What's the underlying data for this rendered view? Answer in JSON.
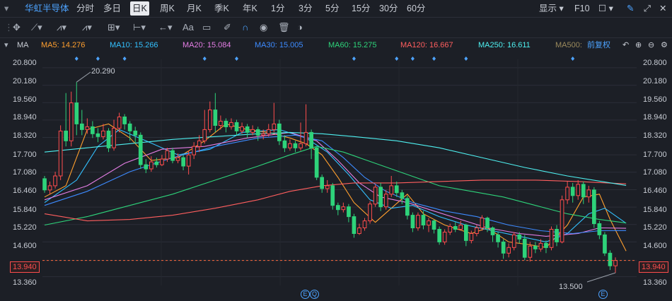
{
  "header": {
    "stock_name": "华虹半导体",
    "periods": [
      "分时",
      "多日",
      "日K",
      "周K",
      "月K",
      "季K",
      "年K",
      "1分",
      "3分",
      "5分",
      "15分",
      "30分",
      "60分"
    ],
    "active_period": "日K",
    "display_label": "显示",
    "f10_label": "F10"
  },
  "toolbar": {
    "text_label": "Aa"
  },
  "ma_bar": {
    "label": "MA",
    "items": [
      {
        "text": "MA5: 14.276",
        "color": "#ff9f2e"
      },
      {
        "text": "MA10: 15.266",
        "color": "#33c1ff"
      },
      {
        "text": "MA20: 15.084",
        "color": "#e57ee5"
      },
      {
        "text": "MA30: 15.005",
        "color": "#3d8bff"
      },
      {
        "text": "MA60: 15.275",
        "color": "#2ed37a"
      },
      {
        "text": "MA120: 16.667",
        "color": "#ff5e5e"
      },
      {
        "text": "MA250: 16.611",
        "color": "#4ef0f0"
      },
      {
        "text": "MA500:",
        "color": "#9b8a5c"
      }
    ],
    "adjust_label": "前复权"
  },
  "chart_data": {
    "type": "candlestick",
    "ylim": [
      13.05,
      21.1
    ],
    "yticks": [
      "20.800",
      "20.180",
      "19.560",
      "18.940",
      "18.320",
      "17.700",
      "17.080",
      "16.460",
      "15.840",
      "15.220",
      "14.600",
      "13.940",
      "13.360"
    ],
    "current_price": "13.940",
    "max_label": "20.290",
    "min_label": "13.500",
    "event_badges": [
      "E",
      "Q",
      "E"
    ],
    "up_color": "#ff4d4d",
    "down_color": "#2ed37a",
    "candles": [
      [
        16.85,
        16.45,
        16.95,
        16.35
      ],
      [
        16.45,
        16.6,
        16.75,
        16.3
      ],
      [
        16.6,
        16.95,
        17.1,
        16.5
      ],
      [
        16.95,
        18.55,
        18.75,
        16.8
      ],
      [
        18.55,
        18.2,
        19.9,
        18.0
      ],
      [
        18.2,
        19.55,
        19.95,
        18.0
      ],
      [
        19.55,
        18.8,
        20.29,
        18.4
      ],
      [
        18.8,
        18.6,
        19.3,
        18.4
      ],
      [
        18.6,
        18.7,
        19.0,
        18.45
      ],
      [
        18.7,
        18.45,
        18.9,
        18.3
      ],
      [
        18.45,
        18.35,
        18.65,
        18.15
      ],
      [
        18.35,
        18.55,
        18.8,
        18.25
      ],
      [
        18.55,
        17.95,
        18.65,
        17.8
      ],
      [
        17.95,
        18.65,
        18.95,
        17.85
      ],
      [
        18.65,
        19.05,
        19.2,
        18.5
      ],
      [
        19.05,
        18.8,
        19.15,
        18.6
      ],
      [
        18.8,
        18.55,
        18.9,
        18.2
      ],
      [
        18.55,
        18.4,
        18.7,
        18.1
      ],
      [
        18.4,
        17.35,
        18.5,
        17.2
      ],
      [
        17.35,
        17.2,
        17.55,
        17.05
      ],
      [
        17.2,
        17.45,
        17.65,
        17.1
      ],
      [
        17.45,
        17.35,
        17.6,
        17.25
      ],
      [
        17.35,
        17.55,
        17.7,
        17.3
      ],
      [
        17.55,
        17.85,
        17.95,
        17.45
      ],
      [
        17.85,
        17.5,
        17.95,
        17.4
      ],
      [
        17.5,
        17.6,
        17.75,
        17.4
      ],
      [
        17.6,
        17.3,
        17.7,
        17.15
      ],
      [
        17.3,
        17.7,
        17.85,
        17.0
      ],
      [
        17.7,
        18.0,
        18.15,
        17.55
      ],
      [
        18.0,
        18.2,
        18.4,
        17.8
      ],
      [
        18.2,
        18.6,
        19.3,
        18.1
      ],
      [
        18.6,
        19.3,
        19.6,
        18.5
      ],
      [
        19.3,
        18.75,
        19.9,
        18.5
      ],
      [
        18.75,
        18.9,
        19.1,
        18.6
      ],
      [
        18.9,
        18.7,
        19.0,
        18.5
      ],
      [
        18.7,
        18.85,
        19.0,
        18.6
      ],
      [
        18.85,
        18.55,
        18.95,
        18.4
      ],
      [
        18.55,
        18.7,
        18.85,
        18.45
      ],
      [
        18.7,
        18.5,
        18.8,
        18.3
      ],
      [
        18.5,
        18.6,
        18.75,
        18.4
      ],
      [
        18.6,
        18.4,
        18.7,
        18.2
      ],
      [
        18.4,
        18.45,
        18.6,
        18.25
      ],
      [
        18.45,
        18.6,
        18.8,
        18.35
      ],
      [
        18.6,
        18.8,
        19.55,
        18.5
      ],
      [
        18.8,
        18.2,
        18.95,
        18.05
      ],
      [
        18.2,
        17.95,
        18.4,
        17.8
      ],
      [
        17.95,
        18.1,
        18.25,
        17.85
      ],
      [
        18.1,
        17.95,
        18.2,
        17.8
      ],
      [
        17.95,
        18.1,
        18.85,
        17.85
      ],
      [
        18.1,
        18.5,
        19.5,
        18.0
      ],
      [
        18.5,
        17.95,
        18.6,
        17.55
      ],
      [
        17.95,
        16.9,
        18.0,
        16.8
      ],
      [
        16.9,
        16.5,
        17.0,
        16.35
      ],
      [
        16.5,
        16.6,
        16.8,
        16.35
      ],
      [
        16.6,
        15.9,
        16.7,
        15.75
      ],
      [
        15.9,
        15.75,
        16.0,
        15.55
      ],
      [
        15.75,
        15.85,
        16.0,
        15.65
      ],
      [
        15.85,
        15.5,
        15.95,
        15.3
      ],
      [
        15.5,
        14.9,
        15.6,
        14.75
      ],
      [
        14.9,
        15.1,
        15.25,
        14.85
      ],
      [
        15.1,
        15.35,
        15.45,
        15.0
      ],
      [
        15.35,
        15.95,
        16.05,
        15.25
      ],
      [
        15.95,
        16.55,
        16.65,
        15.85
      ],
      [
        16.55,
        15.85,
        16.7,
        15.7
      ],
      [
        15.85,
        16.3,
        16.45,
        15.75
      ],
      [
        16.3,
        16.6,
        16.95,
        16.2
      ],
      [
        16.6,
        16.35,
        16.75,
        16.2
      ],
      [
        16.35,
        16.15,
        16.45,
        15.95
      ],
      [
        16.15,
        15.55,
        16.25,
        15.4
      ],
      [
        15.55,
        15.1,
        15.65,
        14.95
      ],
      [
        15.1,
        15.55,
        15.65,
        15.0
      ],
      [
        15.55,
        15.2,
        15.7,
        15.05
      ],
      [
        15.2,
        15.35,
        15.45,
        14.95
      ],
      [
        15.35,
        15.05,
        15.4,
        14.9
      ],
      [
        15.05,
        14.6,
        15.15,
        14.5
      ],
      [
        14.6,
        14.95,
        15.05,
        14.5
      ],
      [
        14.95,
        15.15,
        15.25,
        14.85
      ],
      [
        15.15,
        15.05,
        15.3,
        14.95
      ],
      [
        15.05,
        15.2,
        15.35,
        15.0
      ],
      [
        15.2,
        14.65,
        15.25,
        14.45
      ],
      [
        14.65,
        14.9,
        15.0,
        14.55
      ],
      [
        14.9,
        15.1,
        15.2,
        14.8
      ],
      [
        15.1,
        15.45,
        15.55,
        15.0
      ],
      [
        15.45,
        15.1,
        15.5,
        14.95
      ],
      [
        15.1,
        14.85,
        15.15,
        14.6
      ],
      [
        14.85,
        14.6,
        14.95,
        14.4
      ],
      [
        14.6,
        14.2,
        14.7,
        14.0
      ],
      [
        14.2,
        14.4,
        14.55,
        14.05
      ],
      [
        14.4,
        14.85,
        14.95,
        14.3
      ],
      [
        14.85,
        14.7,
        14.95,
        14.55
      ],
      [
        14.7,
        14.05,
        14.85,
        13.95
      ],
      [
        14.05,
        14.45,
        14.6,
        13.9
      ],
      [
        14.45,
        14.35,
        14.6,
        14.2
      ],
      [
        14.35,
        14.55,
        14.7,
        14.25
      ],
      [
        14.55,
        14.4,
        14.65,
        14.2
      ],
      [
        14.4,
        15.05,
        15.15,
        14.3
      ],
      [
        15.05,
        14.6,
        15.2,
        14.45
      ],
      [
        14.6,
        16.1,
        16.25,
        14.55
      ],
      [
        16.1,
        16.55,
        16.75,
        15.95
      ],
      [
        16.55,
        16.25,
        16.7,
        16.0
      ],
      [
        16.25,
        16.65,
        16.8,
        16.1
      ],
      [
        16.65,
        16.2,
        16.75,
        15.95
      ],
      [
        16.2,
        16.45,
        16.6,
        16.0
      ],
      [
        16.45,
        15.25,
        16.55,
        15.1
      ],
      [
        15.25,
        14.85,
        15.35,
        14.7
      ],
      [
        14.85,
        14.2,
        14.95,
        14.1
      ],
      [
        14.2,
        13.75,
        14.3,
        13.6
      ],
      [
        13.75,
        13.94,
        14.05,
        13.5
      ]
    ],
    "ma_series": [
      {
        "name": "MA5",
        "color": "#ff9f2e",
        "points": [
          [
            16.2,
            0
          ],
          [
            16.6,
            4
          ],
          [
            18.6,
            8
          ],
          [
            18.8,
            12
          ],
          [
            18.3,
            16
          ],
          [
            17.5,
            20
          ],
          [
            17.6,
            25
          ],
          [
            18.2,
            30
          ],
          [
            18.8,
            34
          ],
          [
            18.6,
            38
          ],
          [
            18.5,
            42
          ],
          [
            18.3,
            46
          ],
          [
            18.1,
            49
          ],
          [
            17.7,
            52
          ],
          [
            16.9,
            55
          ],
          [
            16.0,
            58
          ],
          [
            15.3,
            62
          ],
          [
            15.8,
            65
          ],
          [
            16.3,
            68
          ],
          [
            15.6,
            71
          ],
          [
            15.2,
            75
          ],
          [
            14.9,
            80
          ],
          [
            15.1,
            83
          ],
          [
            14.6,
            87
          ],
          [
            14.5,
            91
          ],
          [
            14.4,
            94
          ],
          [
            15.2,
            98
          ],
          [
            16.2,
            101
          ],
          [
            16.3,
            104
          ],
          [
            15.4,
            106
          ],
          [
            14.276,
            109
          ]
        ]
      },
      {
        "name": "MA10",
        "color": "#33c1ff",
        "points": [
          [
            16.0,
            0
          ],
          [
            16.8,
            6
          ],
          [
            18.0,
            10
          ],
          [
            18.6,
            14
          ],
          [
            18.2,
            19
          ],
          [
            17.7,
            25
          ],
          [
            17.9,
            31
          ],
          [
            18.5,
            37
          ],
          [
            18.6,
            44
          ],
          [
            18.3,
            49
          ],
          [
            17.8,
            53
          ],
          [
            17.0,
            57
          ],
          [
            16.1,
            61
          ],
          [
            15.8,
            65
          ],
          [
            15.9,
            69
          ],
          [
            15.5,
            74
          ],
          [
            15.2,
            79
          ],
          [
            15.0,
            84
          ],
          [
            14.8,
            89
          ],
          [
            14.6,
            94
          ],
          [
            14.9,
            98
          ],
          [
            15.6,
            102
          ],
          [
            15.8,
            105
          ],
          [
            15.266,
            109
          ]
        ]
      },
      {
        "name": "MA20",
        "color": "#e57ee5",
        "points": [
          [
            16.1,
            0
          ],
          [
            16.6,
            8
          ],
          [
            17.4,
            15
          ],
          [
            17.9,
            22
          ],
          [
            18.0,
            30
          ],
          [
            18.3,
            38
          ],
          [
            18.5,
            46
          ],
          [
            18.2,
            51
          ],
          [
            17.5,
            55
          ],
          [
            16.7,
            59
          ],
          [
            16.2,
            63
          ],
          [
            16.0,
            68
          ],
          [
            15.7,
            73
          ],
          [
            15.4,
            78
          ],
          [
            15.1,
            83
          ],
          [
            14.9,
            89
          ],
          [
            14.8,
            94
          ],
          [
            14.9,
            100
          ],
          [
            15.1,
            104
          ],
          [
            15.084,
            109
          ]
        ]
      },
      {
        "name": "MA30",
        "color": "#3d8bff",
        "points": [
          [
            15.9,
            0
          ],
          [
            16.4,
            8
          ],
          [
            17.1,
            16
          ],
          [
            17.6,
            24
          ],
          [
            18.0,
            32
          ],
          [
            18.3,
            40
          ],
          [
            18.4,
            47
          ],
          [
            18.2,
            52
          ],
          [
            17.6,
            56
          ],
          [
            16.9,
            60
          ],
          [
            16.4,
            64
          ],
          [
            16.0,
            69
          ],
          [
            15.7,
            75
          ],
          [
            15.5,
            81
          ],
          [
            15.2,
            87
          ],
          [
            15.0,
            93
          ],
          [
            14.9,
            99
          ],
          [
            15.0,
            104
          ],
          [
            15.005,
            109
          ]
        ]
      },
      {
        "name": "MA60",
        "color": "#2ed37a",
        "points": [
          [
            15.2,
            0
          ],
          [
            15.5,
            8
          ],
          [
            15.9,
            16
          ],
          [
            16.3,
            24
          ],
          [
            16.8,
            32
          ],
          [
            17.3,
            40
          ],
          [
            17.7,
            46
          ],
          [
            18.0,
            51
          ],
          [
            17.8,
            56
          ],
          [
            17.4,
            62
          ],
          [
            17.0,
            68
          ],
          [
            16.6,
            74
          ],
          [
            16.4,
            80
          ],
          [
            16.2,
            86
          ],
          [
            15.9,
            92
          ],
          [
            15.6,
            98
          ],
          [
            15.4,
            104
          ],
          [
            15.275,
            109
          ]
        ]
      },
      {
        "name": "MA120",
        "color": "#ff5e5e",
        "points": [
          [
            15.6,
            0
          ],
          [
            15.35,
            8
          ],
          [
            15.4,
            16
          ],
          [
            15.55,
            24
          ],
          [
            15.8,
            32
          ],
          [
            16.1,
            40
          ],
          [
            16.4,
            46
          ],
          [
            16.6,
            52
          ],
          [
            16.7,
            58
          ],
          [
            16.7,
            66
          ],
          [
            16.75,
            74
          ],
          [
            16.8,
            82
          ],
          [
            16.8,
            92
          ],
          [
            16.75,
            100
          ],
          [
            16.667,
            109
          ]
        ]
      },
      {
        "name": "MA250",
        "color": "#4ef0f0",
        "points": [
          [
            17.8,
            0
          ],
          [
            17.95,
            8
          ],
          [
            18.1,
            16
          ],
          [
            18.25,
            24
          ],
          [
            18.35,
            32
          ],
          [
            18.45,
            40
          ],
          [
            18.5,
            46
          ],
          [
            18.45,
            52
          ],
          [
            18.35,
            58
          ],
          [
            18.2,
            66
          ],
          [
            17.95,
            74
          ],
          [
            17.6,
            82
          ],
          [
            17.25,
            90
          ],
          [
            16.95,
            98
          ],
          [
            16.611,
            109
          ]
        ]
      }
    ]
  }
}
